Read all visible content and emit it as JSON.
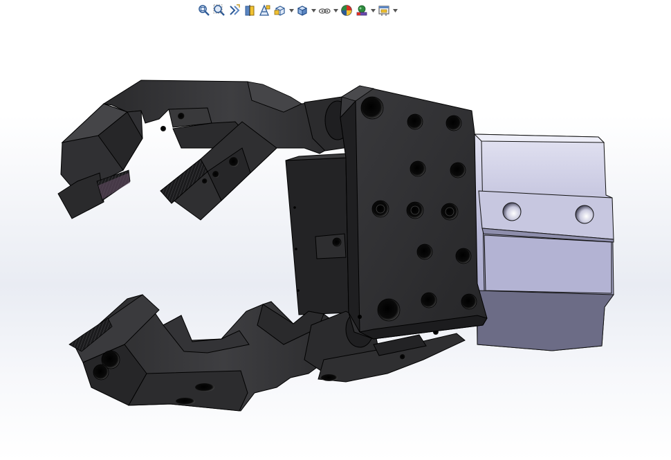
{
  "window": {
    "type": "3D CAD model viewport"
  },
  "heads_up_toolbar": {
    "buttons": [
      {
        "icon": "zoom-to-fit-icon",
        "has_dropdown": false
      },
      {
        "icon": "zoom-to-area-icon",
        "has_dropdown": false
      },
      {
        "icon": "previous-view-icon",
        "has_dropdown": false
      },
      {
        "icon": "section-view-icon",
        "has_dropdown": false
      },
      {
        "icon": "dynamic-annotation-views-icon",
        "has_dropdown": false
      },
      {
        "icon": "view-orientation-icon",
        "has_dropdown": true
      },
      {
        "icon": "display-style-icon",
        "has_dropdown": true
      },
      {
        "icon": "hide-show-items-icon",
        "has_dropdown": true
      },
      {
        "icon": "edit-appearance-icon",
        "has_dropdown": false
      },
      {
        "icon": "apply-scene-icon",
        "has_dropdown": true
      },
      {
        "icon": "view-settings-icon",
        "has_dropdown": true
      }
    ]
  },
  "model": {
    "description_visible": false,
    "colors": {
      "gripper_body": "#2e2e30",
      "gripper_shadow": "#1c1c1e",
      "gripper_highlight": "#4a4a4d",
      "cylinder_body": "#b9b9d8",
      "cylinder_shadow": "#6f6f8a",
      "cylinder_top": "#dcdcee",
      "jaw_pad": "#5d4a5e",
      "background_top": "#ffffff",
      "background_band": "#e9ecf3"
    }
  }
}
